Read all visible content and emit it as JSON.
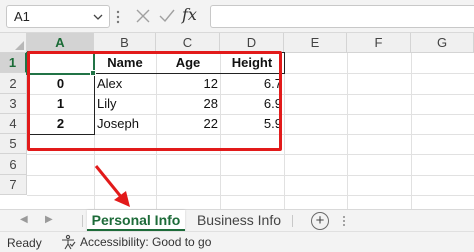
{
  "formula_bar": {
    "name_box": "A1",
    "cancel_icon": "close-icon",
    "enter_icon": "check-icon",
    "function_icon": "fx-icon",
    "function_label": "fx",
    "formula": ""
  },
  "grid": {
    "columns": [
      "A",
      "B",
      "C",
      "D",
      "E",
      "F",
      "G"
    ],
    "rows": [
      "1",
      "2",
      "3",
      "4",
      "5",
      "6",
      "7"
    ],
    "selected_cell": "A1",
    "headers": {
      "name": "Name",
      "age": "Age",
      "height": "Height"
    },
    "data": [
      {
        "index": "0",
        "name": "Alex",
        "age": "12",
        "height": "6.7"
      },
      {
        "index": "1",
        "name": "Lily",
        "age": "28",
        "height": "6.9"
      },
      {
        "index": "2",
        "name": "Joseph",
        "age": "22",
        "height": "5.9"
      }
    ]
  },
  "sheet_tabs": {
    "tabs": [
      {
        "label": "Personal Info",
        "active": true
      },
      {
        "label": "Business Info",
        "active": false
      }
    ],
    "add_label": "+"
  },
  "status_bar": {
    "ready": "Ready",
    "accessibility": "Accessibility: Good to go"
  },
  "colors": {
    "annotation_red": "#e21a1a",
    "excel_green": "#217346"
  }
}
